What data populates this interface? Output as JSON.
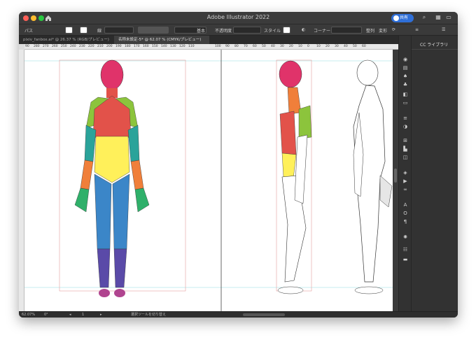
{
  "titlebar": {
    "app_title": "Adobe Illustrator 2022",
    "share_label": "共有"
  },
  "control_bar": {
    "selection_type": "パス",
    "stroke_style_label": "基本",
    "opacity_label": "不透明度",
    "style_label": "スタイル",
    "corner_label": "コーナー",
    "align_label": "整列",
    "transform_label": "変形",
    "stroke_label": "線"
  },
  "tabs": [
    {
      "label": "pixiv_fanbox.ai* @ 26.37 % (RGB/プレビュー)",
      "active": false
    },
    {
      "label": "名称未設定-5* @ 62.07 % (CMYK/プレビュー)",
      "active": true
    }
  ],
  "ruler": {
    "top_ticks": [
      "90",
      "280",
      "270",
      "260",
      "250",
      "240",
      "230",
      "220",
      "210",
      "200",
      "190",
      "180",
      "170",
      "160",
      "150",
      "140",
      "130",
      "120",
      "110",
      "100",
      "90",
      "80",
      "70",
      "60",
      "50",
      "40",
      "30",
      "20",
      "10",
      "0",
      "10",
      "20",
      "30",
      "40",
      "50",
      "60"
    ]
  },
  "cc_panel": {
    "title": "CC ライブラリ"
  },
  "status_bar": {
    "zoom": "62.07%",
    "rotation": "0°",
    "artboard_number": "1",
    "tool_hint": "選択ツールを切り替え"
  },
  "colors": {
    "head": "#e0336a",
    "shoulder": "#8cc43c",
    "chest": "#e2524a",
    "abdomen": "#fff05a",
    "arm": "#2aa39a",
    "forearm": "#f07f3a",
    "hand": "#2fb06a",
    "thigh": "#3b86c8",
    "shin": "#5a4aa8",
    "foot": "#b0448f",
    "share_button": "#2f6fd8"
  }
}
